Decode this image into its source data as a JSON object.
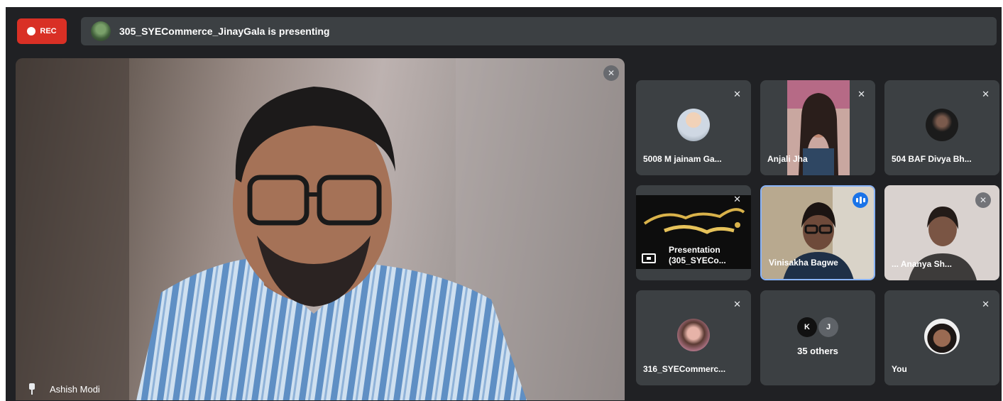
{
  "top_bar": {
    "rec_label": "REC",
    "presenting_text": "305_SYECommerce_JinayGala is presenting"
  },
  "main_speaker": {
    "name": "Ashish Modi"
  },
  "tiles": [
    {
      "name": "5008 M jainam Ga...",
      "muted": true
    },
    {
      "name": "Anjali Jha",
      "muted": true
    },
    {
      "name": "504 BAF Divya Bh...",
      "muted": true
    },
    {
      "name_line1": "Presentation",
      "name_line2": "(305_SYECo...",
      "muted": true
    },
    {
      "name": "Vinisakha Bagwe",
      "speaking": true
    },
    {
      "name": "... Ananya Sh...",
      "muted": true
    },
    {
      "name": "316_SYECommerc...",
      "muted": true
    },
    {
      "others_label": "35 others",
      "circle_a": "K",
      "circle_b": "J"
    },
    {
      "name": "You",
      "muted": true
    }
  ],
  "colors": {
    "rec_red": "#d93025",
    "meet_bg": "#202124",
    "tile_bg": "#3c4043",
    "speaking_blue": "#1a73e8"
  },
  "icons": [
    "record-dot-icon",
    "pin-icon",
    "mic-off-icon",
    "speaking-indicator-icon",
    "present-screen-icon"
  ]
}
